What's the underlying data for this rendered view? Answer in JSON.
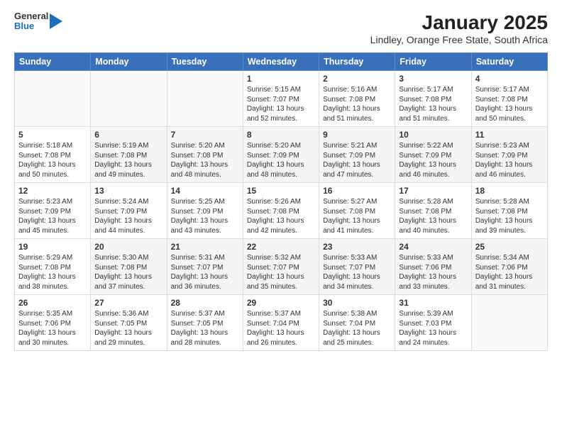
{
  "logo": {
    "general": "General",
    "blue": "Blue"
  },
  "title": "January 2025",
  "subtitle": "Lindley, Orange Free State, South Africa",
  "weekdays": [
    "Sunday",
    "Monday",
    "Tuesday",
    "Wednesday",
    "Thursday",
    "Friday",
    "Saturday"
  ],
  "weeks": [
    [
      {
        "day": "",
        "info": ""
      },
      {
        "day": "",
        "info": ""
      },
      {
        "day": "",
        "info": ""
      },
      {
        "day": "1",
        "info": "Sunrise: 5:15 AM\nSunset: 7:07 PM\nDaylight: 13 hours and 52 minutes."
      },
      {
        "day": "2",
        "info": "Sunrise: 5:16 AM\nSunset: 7:08 PM\nDaylight: 13 hours and 51 minutes."
      },
      {
        "day": "3",
        "info": "Sunrise: 5:17 AM\nSunset: 7:08 PM\nDaylight: 13 hours and 51 minutes."
      },
      {
        "day": "4",
        "info": "Sunrise: 5:17 AM\nSunset: 7:08 PM\nDaylight: 13 hours and 50 minutes."
      }
    ],
    [
      {
        "day": "5",
        "info": "Sunrise: 5:18 AM\nSunset: 7:08 PM\nDaylight: 13 hours and 50 minutes."
      },
      {
        "day": "6",
        "info": "Sunrise: 5:19 AM\nSunset: 7:08 PM\nDaylight: 13 hours and 49 minutes."
      },
      {
        "day": "7",
        "info": "Sunrise: 5:20 AM\nSunset: 7:08 PM\nDaylight: 13 hours and 48 minutes."
      },
      {
        "day": "8",
        "info": "Sunrise: 5:20 AM\nSunset: 7:09 PM\nDaylight: 13 hours and 48 minutes."
      },
      {
        "day": "9",
        "info": "Sunrise: 5:21 AM\nSunset: 7:09 PM\nDaylight: 13 hours and 47 minutes."
      },
      {
        "day": "10",
        "info": "Sunrise: 5:22 AM\nSunset: 7:09 PM\nDaylight: 13 hours and 46 minutes."
      },
      {
        "day": "11",
        "info": "Sunrise: 5:23 AM\nSunset: 7:09 PM\nDaylight: 13 hours and 46 minutes."
      }
    ],
    [
      {
        "day": "12",
        "info": "Sunrise: 5:23 AM\nSunset: 7:09 PM\nDaylight: 13 hours and 45 minutes."
      },
      {
        "day": "13",
        "info": "Sunrise: 5:24 AM\nSunset: 7:09 PM\nDaylight: 13 hours and 44 minutes."
      },
      {
        "day": "14",
        "info": "Sunrise: 5:25 AM\nSunset: 7:09 PM\nDaylight: 13 hours and 43 minutes."
      },
      {
        "day": "15",
        "info": "Sunrise: 5:26 AM\nSunset: 7:08 PM\nDaylight: 13 hours and 42 minutes."
      },
      {
        "day": "16",
        "info": "Sunrise: 5:27 AM\nSunset: 7:08 PM\nDaylight: 13 hours and 41 minutes."
      },
      {
        "day": "17",
        "info": "Sunrise: 5:28 AM\nSunset: 7:08 PM\nDaylight: 13 hours and 40 minutes."
      },
      {
        "day": "18",
        "info": "Sunrise: 5:28 AM\nSunset: 7:08 PM\nDaylight: 13 hours and 39 minutes."
      }
    ],
    [
      {
        "day": "19",
        "info": "Sunrise: 5:29 AM\nSunset: 7:08 PM\nDaylight: 13 hours and 38 minutes."
      },
      {
        "day": "20",
        "info": "Sunrise: 5:30 AM\nSunset: 7:08 PM\nDaylight: 13 hours and 37 minutes."
      },
      {
        "day": "21",
        "info": "Sunrise: 5:31 AM\nSunset: 7:07 PM\nDaylight: 13 hours and 36 minutes."
      },
      {
        "day": "22",
        "info": "Sunrise: 5:32 AM\nSunset: 7:07 PM\nDaylight: 13 hours and 35 minutes."
      },
      {
        "day": "23",
        "info": "Sunrise: 5:33 AM\nSunset: 7:07 PM\nDaylight: 13 hours and 34 minutes."
      },
      {
        "day": "24",
        "info": "Sunrise: 5:33 AM\nSunset: 7:06 PM\nDaylight: 13 hours and 33 minutes."
      },
      {
        "day": "25",
        "info": "Sunrise: 5:34 AM\nSunset: 7:06 PM\nDaylight: 13 hours and 31 minutes."
      }
    ],
    [
      {
        "day": "26",
        "info": "Sunrise: 5:35 AM\nSunset: 7:06 PM\nDaylight: 13 hours and 30 minutes."
      },
      {
        "day": "27",
        "info": "Sunrise: 5:36 AM\nSunset: 7:05 PM\nDaylight: 13 hours and 29 minutes."
      },
      {
        "day": "28",
        "info": "Sunrise: 5:37 AM\nSunset: 7:05 PM\nDaylight: 13 hours and 28 minutes."
      },
      {
        "day": "29",
        "info": "Sunrise: 5:37 AM\nSunset: 7:04 PM\nDaylight: 13 hours and 26 minutes."
      },
      {
        "day": "30",
        "info": "Sunrise: 5:38 AM\nSunset: 7:04 PM\nDaylight: 13 hours and 25 minutes."
      },
      {
        "day": "31",
        "info": "Sunrise: 5:39 AM\nSunset: 7:03 PM\nDaylight: 13 hours and 24 minutes."
      },
      {
        "day": "",
        "info": ""
      }
    ]
  ]
}
